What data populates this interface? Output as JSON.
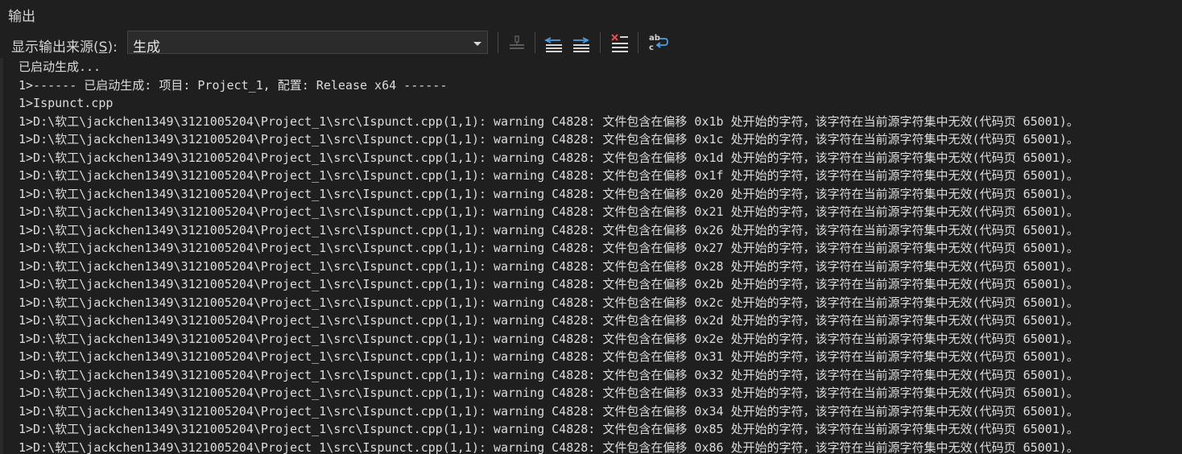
{
  "panel": {
    "title": "输出"
  },
  "toolbar": {
    "source_label_prefix": "显示输出来源(",
    "source_label_key": "S",
    "source_label_suffix": "):",
    "source_selected": "生成",
    "buttons": [
      {
        "name": "find-message-in-code-icon",
        "enabled": false
      },
      {
        "name": "go-to-previous-message-icon",
        "enabled": true
      },
      {
        "name": "go-to-next-message-icon",
        "enabled": true
      },
      {
        "name": "clear-all-icon",
        "enabled": true
      },
      {
        "name": "toggle-word-wrap-icon",
        "enabled": true
      }
    ]
  },
  "output": {
    "lines": [
      "已启动生成...",
      "1>------ 已启动生成: 项目: Project_1, 配置: Release x64 ------",
      "1>Ispunct.cpp",
      "1>D:\\软工\\jackchen1349\\3121005204\\Project_1\\src\\Ispunct.cpp(1,1): warning C4828: 文件包含在偏移 0x1b 处开始的字符，该字符在当前源字符集中无效(代码页 65001)。",
      "1>D:\\软工\\jackchen1349\\3121005204\\Project_1\\src\\Ispunct.cpp(1,1): warning C4828: 文件包含在偏移 0x1c 处开始的字符，该字符在当前源字符集中无效(代码页 65001)。",
      "1>D:\\软工\\jackchen1349\\3121005204\\Project_1\\src\\Ispunct.cpp(1,1): warning C4828: 文件包含在偏移 0x1d 处开始的字符，该字符在当前源字符集中无效(代码页 65001)。",
      "1>D:\\软工\\jackchen1349\\3121005204\\Project_1\\src\\Ispunct.cpp(1,1): warning C4828: 文件包含在偏移 0x1f 处开始的字符，该字符在当前源字符集中无效(代码页 65001)。",
      "1>D:\\软工\\jackchen1349\\3121005204\\Project_1\\src\\Ispunct.cpp(1,1): warning C4828: 文件包含在偏移 0x20 处开始的字符，该字符在当前源字符集中无效(代码页 65001)。",
      "1>D:\\软工\\jackchen1349\\3121005204\\Project_1\\src\\Ispunct.cpp(1,1): warning C4828: 文件包含在偏移 0x21 处开始的字符，该字符在当前源字符集中无效(代码页 65001)。",
      "1>D:\\软工\\jackchen1349\\3121005204\\Project_1\\src\\Ispunct.cpp(1,1): warning C4828: 文件包含在偏移 0x26 处开始的字符，该字符在当前源字符集中无效(代码页 65001)。",
      "1>D:\\软工\\jackchen1349\\3121005204\\Project_1\\src\\Ispunct.cpp(1,1): warning C4828: 文件包含在偏移 0x27 处开始的字符，该字符在当前源字符集中无效(代码页 65001)。",
      "1>D:\\软工\\jackchen1349\\3121005204\\Project_1\\src\\Ispunct.cpp(1,1): warning C4828: 文件包含在偏移 0x28 处开始的字符，该字符在当前源字符集中无效(代码页 65001)。",
      "1>D:\\软工\\jackchen1349\\3121005204\\Project_1\\src\\Ispunct.cpp(1,1): warning C4828: 文件包含在偏移 0x2b 处开始的字符，该字符在当前源字符集中无效(代码页 65001)。",
      "1>D:\\软工\\jackchen1349\\3121005204\\Project_1\\src\\Ispunct.cpp(1,1): warning C4828: 文件包含在偏移 0x2c 处开始的字符，该字符在当前源字符集中无效(代码页 65001)。",
      "1>D:\\软工\\jackchen1349\\3121005204\\Project_1\\src\\Ispunct.cpp(1,1): warning C4828: 文件包含在偏移 0x2d 处开始的字符，该字符在当前源字符集中无效(代码页 65001)。",
      "1>D:\\软工\\jackchen1349\\3121005204\\Project_1\\src\\Ispunct.cpp(1,1): warning C4828: 文件包含在偏移 0x2e 处开始的字符，该字符在当前源字符集中无效(代码页 65001)。",
      "1>D:\\软工\\jackchen1349\\3121005204\\Project_1\\src\\Ispunct.cpp(1,1): warning C4828: 文件包含在偏移 0x31 处开始的字符，该字符在当前源字符集中无效(代码页 65001)。",
      "1>D:\\软工\\jackchen1349\\3121005204\\Project_1\\src\\Ispunct.cpp(1,1): warning C4828: 文件包含在偏移 0x32 处开始的字符，该字符在当前源字符集中无效(代码页 65001)。",
      "1>D:\\软工\\jackchen1349\\3121005204\\Project_1\\src\\Ispunct.cpp(1,1): warning C4828: 文件包含在偏移 0x33 处开始的字符，该字符在当前源字符集中无效(代码页 65001)。",
      "1>D:\\软工\\jackchen1349\\3121005204\\Project_1\\src\\Ispunct.cpp(1,1): warning C4828: 文件包含在偏移 0x34 处开始的字符，该字符在当前源字符集中无效(代码页 65001)。",
      "1>D:\\软工\\jackchen1349\\3121005204\\Project_1\\src\\Ispunct.cpp(1,1): warning C4828: 文件包含在偏移 0x85 处开始的字符，该字符在当前源字符集中无效(代码页 65001)。",
      "1>D:\\软工\\jackchen1349\\3121005204\\Project_1\\src\\Ispunct.cpp(1,1): warning C4828: 文件包含在偏移 0x86 处开始的字符，该字符在当前源字符集中无效(代码页 65001)。"
    ]
  },
  "colors": {
    "background": "#1f1f1f",
    "text": "#dcdcdc",
    "accent_blue": "#4aa0e6",
    "clear_red": "#e05252"
  }
}
